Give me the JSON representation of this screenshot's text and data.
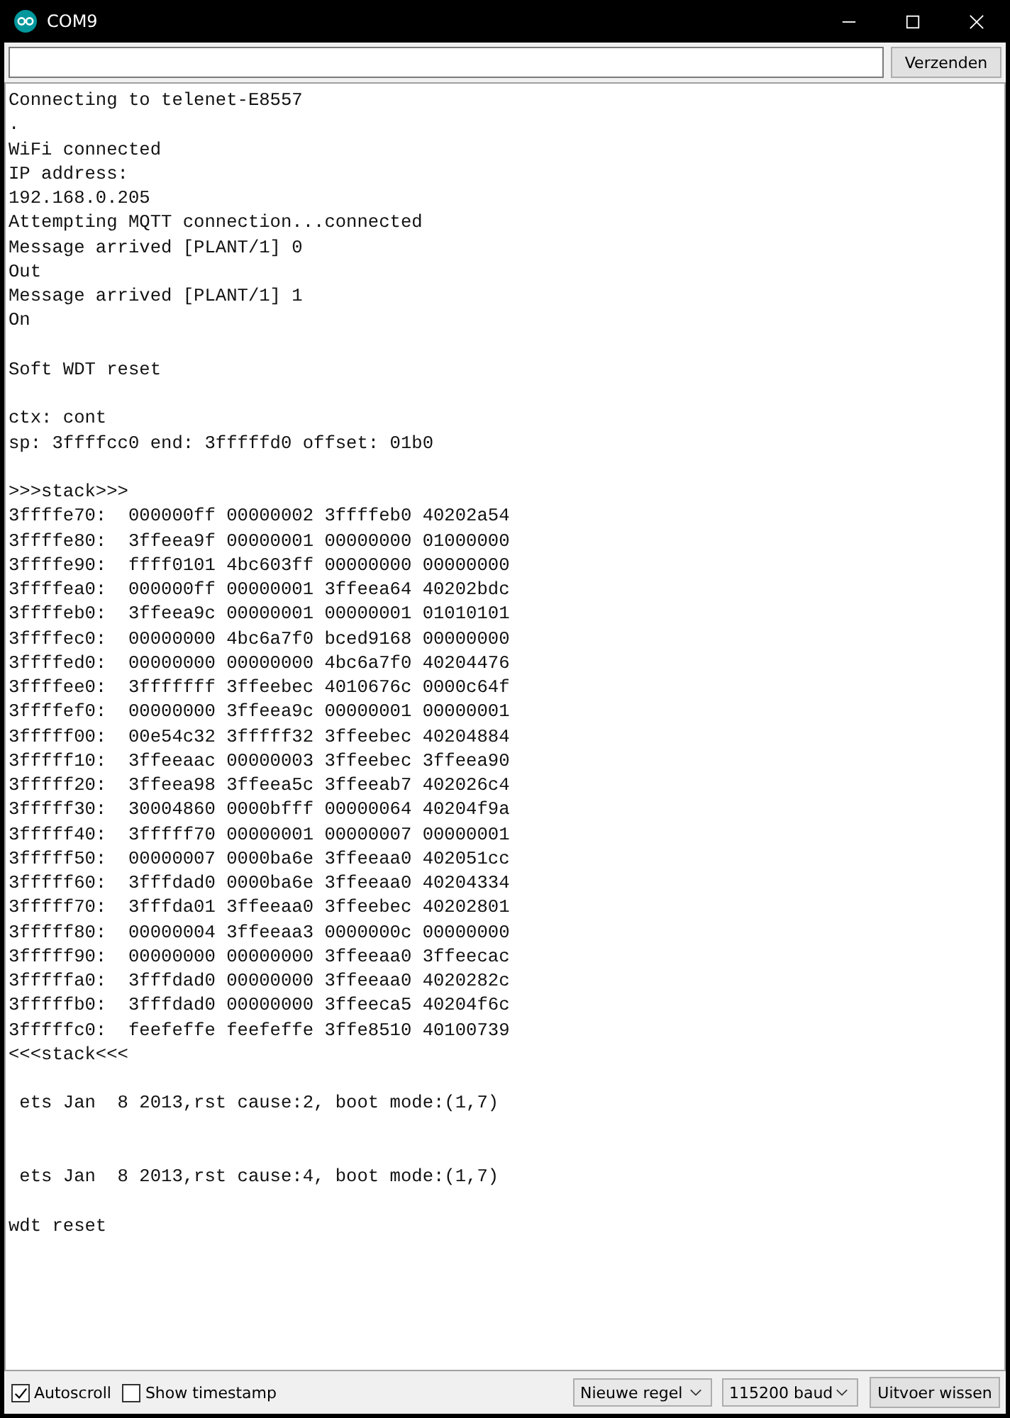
{
  "window": {
    "title": "COM9"
  },
  "send_bar": {
    "button": "Verzenden"
  },
  "output": {
    "lines": [
      {
        "kind": "text",
        "text": "Connecting to telenet-E8557"
      },
      {
        "kind": "text",
        "text": "."
      },
      {
        "kind": "text",
        "text": "WiFi connected"
      },
      {
        "kind": "text",
        "text": "IP address:"
      },
      {
        "kind": "text",
        "text": "192.168.0.205"
      },
      {
        "kind": "text",
        "text": "Attempting MQTT connection...connected"
      },
      {
        "kind": "text",
        "text": "Message arrived [PLANT/1] 0"
      },
      {
        "kind": "text",
        "text": "Out"
      },
      {
        "kind": "text",
        "text": "Message arrived [PLANT/1] 1"
      },
      {
        "kind": "text",
        "text": "On"
      },
      {
        "kind": "blank"
      },
      {
        "kind": "text",
        "text": "Soft WDT reset"
      },
      {
        "kind": "blank"
      },
      {
        "kind": "text",
        "text": "ctx: cont"
      },
      {
        "kind": "text",
        "text": "sp: 3ffffcc0 end: 3fffffd0 offset: 01b0"
      },
      {
        "kind": "blank"
      },
      {
        "kind": "text",
        "text": ">>>stack>>>"
      },
      {
        "kind": "text",
        "text": "3ffffe70:  000000ff 00000002 3ffffeb0 40202a54"
      },
      {
        "kind": "text",
        "text": "3ffffe80:  3ffeea9f 00000001 00000000 01000000"
      },
      {
        "kind": "text",
        "text": "3ffffe90:  ffff0101 4bc603ff 00000000 00000000"
      },
      {
        "kind": "text",
        "text": "3ffffea0:  000000ff 00000001 3ffeea64 40202bdc"
      },
      {
        "kind": "text",
        "text": "3ffffeb0:  3ffeea9c 00000001 00000001 01010101"
      },
      {
        "kind": "text",
        "text": "3ffffec0:  00000000 4bc6a7f0 bced9168 00000000"
      },
      {
        "kind": "text",
        "text": "3ffffed0:  00000000 00000000 4bc6a7f0 40204476"
      },
      {
        "kind": "text",
        "text": "3ffffee0:  3fffffff 3ffeebec 4010676c 0000c64f"
      },
      {
        "kind": "text",
        "text": "3ffffef0:  00000000 3ffeea9c 00000001 00000001"
      },
      {
        "kind": "text",
        "text": "3fffff00:  00e54c32 3fffff32 3ffeebec 40204884"
      },
      {
        "kind": "text",
        "text": "3fffff10:  3ffeeaac 00000003 3ffeebec 3ffeea90"
      },
      {
        "kind": "text",
        "text": "3fffff20:  3ffeea98 3ffeea5c 3ffeeab7 402026c4"
      },
      {
        "kind": "text",
        "text": "3fffff30:  30004860 0000bfff 00000064 40204f9a"
      },
      {
        "kind": "text",
        "text": "3fffff40:  3fffff70 00000001 00000007 00000001"
      },
      {
        "kind": "text",
        "text": "3fffff50:  00000007 0000ba6e 3ffeeaa0 402051cc"
      },
      {
        "kind": "text",
        "text": "3fffff60:  3fffdad0 0000ba6e 3ffeeaa0 40204334"
      },
      {
        "kind": "text",
        "text": "3fffff70:  3fffda01 3ffeeaa0 3ffeebec 40202801"
      },
      {
        "kind": "text",
        "text": "3fffff80:  00000004 3ffeeaa3 0000000c 00000000"
      },
      {
        "kind": "text",
        "text": "3fffff90:  00000000 00000000 3ffeeaa0 3ffeecac"
      },
      {
        "kind": "text",
        "text": "3fffffa0:  3fffdad0 00000000 3ffeeaa0 4020282c"
      },
      {
        "kind": "text",
        "text": "3fffffb0:  3fffdad0 00000000 3ffeeca5 40204f6c"
      },
      {
        "kind": "text",
        "text": "3fffffc0:  feefeffe feefeffe 3ffe8510 40100739"
      },
      {
        "kind": "text",
        "text": "<<<stack<<<"
      },
      {
        "kind": "blank"
      },
      {
        "kind": "text",
        "text": " ets Jan  8 2013,rst cause:2, boot mode:(1,7)"
      },
      {
        "kind": "blank"
      },
      {
        "kind": "blank"
      },
      {
        "kind": "text",
        "text": " ets Jan  8 2013,rst cause:4, boot mode:(1,7)"
      },
      {
        "kind": "blank"
      },
      {
        "kind": "text",
        "text": "wdt reset"
      }
    ]
  },
  "footer": {
    "autoscroll": {
      "label": "Autoscroll",
      "checked": true
    },
    "timestamp": {
      "label": "Show timestamp",
      "checked": false
    },
    "line_ending": "Nieuwe regel",
    "baud": "115200 baud",
    "clear_button": "Uitvoer wissen"
  }
}
